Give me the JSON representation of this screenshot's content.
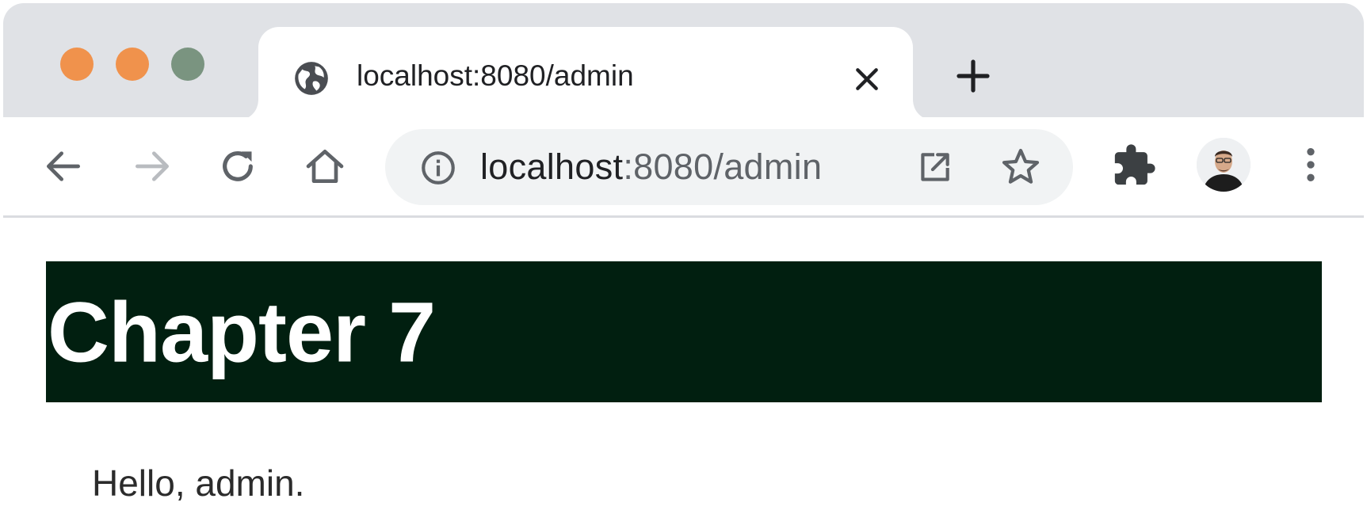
{
  "browser": {
    "tab": {
      "title": "localhost:8080/admin",
      "favicon": "globe-icon"
    },
    "toolbar": {
      "address_host": "localhost",
      "address_rest": ":8080/admin",
      "icons": [
        "back-arrow-icon",
        "forward-arrow-icon",
        "reload-icon",
        "home-icon",
        "info-icon",
        "open-in-new-icon",
        "star-icon",
        "extensions-icon",
        "avatar",
        "more-vert-icon"
      ]
    },
    "colors": {
      "tabstrip": "#e0e2e6",
      "traffic_close": "#f0924c",
      "traffic_minimize": "#f0924c",
      "traffic_maximize": "#7a9480"
    }
  },
  "page": {
    "heading": "Chapter 7",
    "greeting": "Hello, admin.",
    "colors": {
      "banner_background": "#011f10",
      "heading_text": "#ffffff"
    }
  }
}
